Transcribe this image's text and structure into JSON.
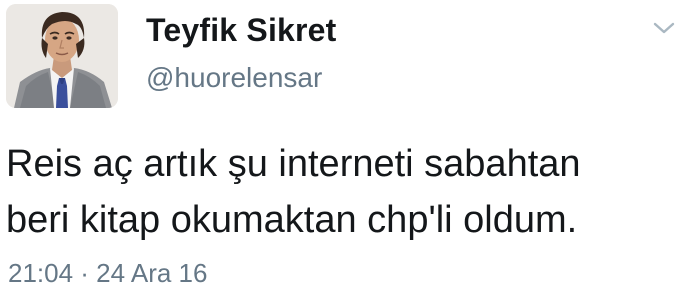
{
  "author": {
    "display_name": "Teyfik Sikret",
    "handle": "@huorelensar"
  },
  "tweet": {
    "lines": [
      "Reis aç artık şu interneti sabahtan",
      "beri kitap okumaktan chp'li oldum."
    ],
    "timestamp": "21:04 · 24 Ara 16"
  },
  "icons": {
    "menu": "chevron-down-icon"
  },
  "colors": {
    "name": "#14171a",
    "secondary": "#657786",
    "background": "#ffffff"
  }
}
